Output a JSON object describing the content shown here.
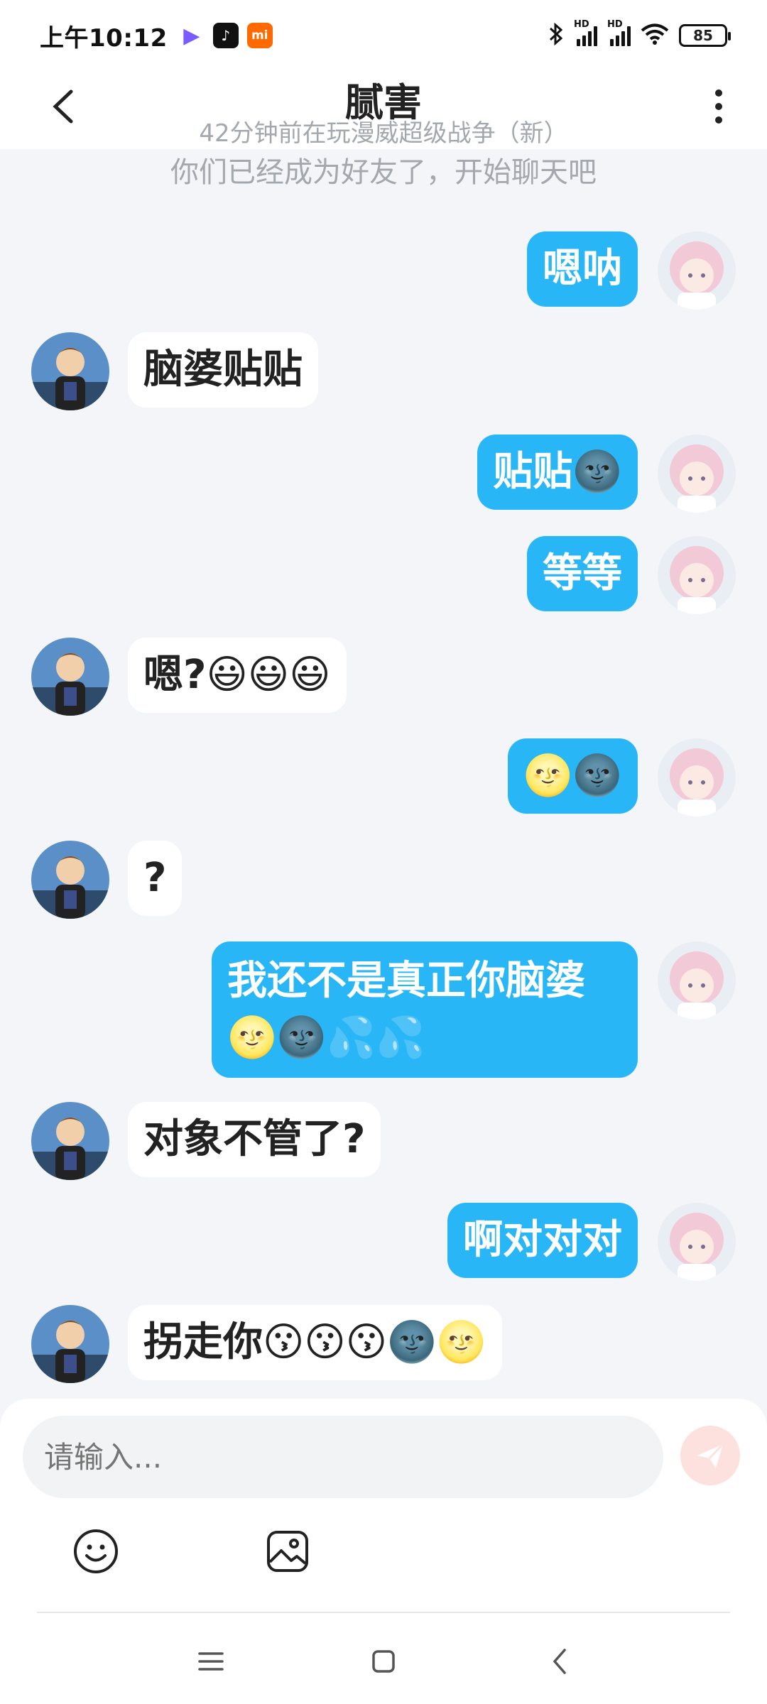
{
  "status_bar": {
    "time": "上午10:12",
    "battery": "85",
    "icons": [
      "video-app-icon",
      "tiktok-icon",
      "mi-icon",
      "bluetooth-icon",
      "hd-signal-icon",
      "hd-signal-icon",
      "wifi-icon",
      "battery-icon"
    ]
  },
  "header": {
    "title": "腻害",
    "subtitle": "42分钟前在玩漫威超级战争（新）"
  },
  "system_note": "你们已经成为好友了，开始聊天吧",
  "messages": [
    {
      "side": "right",
      "text": "嗯呐"
    },
    {
      "side": "left",
      "text": "脑婆贴贴"
    },
    {
      "side": "right",
      "text": "贴贴🌚"
    },
    {
      "side": "right",
      "text": "等等"
    },
    {
      "side": "left",
      "text": "嗯?😃😃😃"
    },
    {
      "side": "right",
      "text": "🌝🌚"
    },
    {
      "side": "left",
      "text": "?"
    },
    {
      "side": "right",
      "text": "我还不是真正你脑婆🌝🌚💦💦"
    },
    {
      "side": "left",
      "text": "对象不管了?"
    },
    {
      "side": "right",
      "text": "啊对对对"
    },
    {
      "side": "left",
      "text": "拐走你😗😗😗🌚🌝"
    }
  ],
  "input": {
    "placeholder": "请输入..."
  },
  "colors": {
    "outgoing_bubble": "#29b6f6",
    "incoming_bubble": "#ffffff",
    "background": "#f3f5f8",
    "send_button": "#fde1df"
  }
}
